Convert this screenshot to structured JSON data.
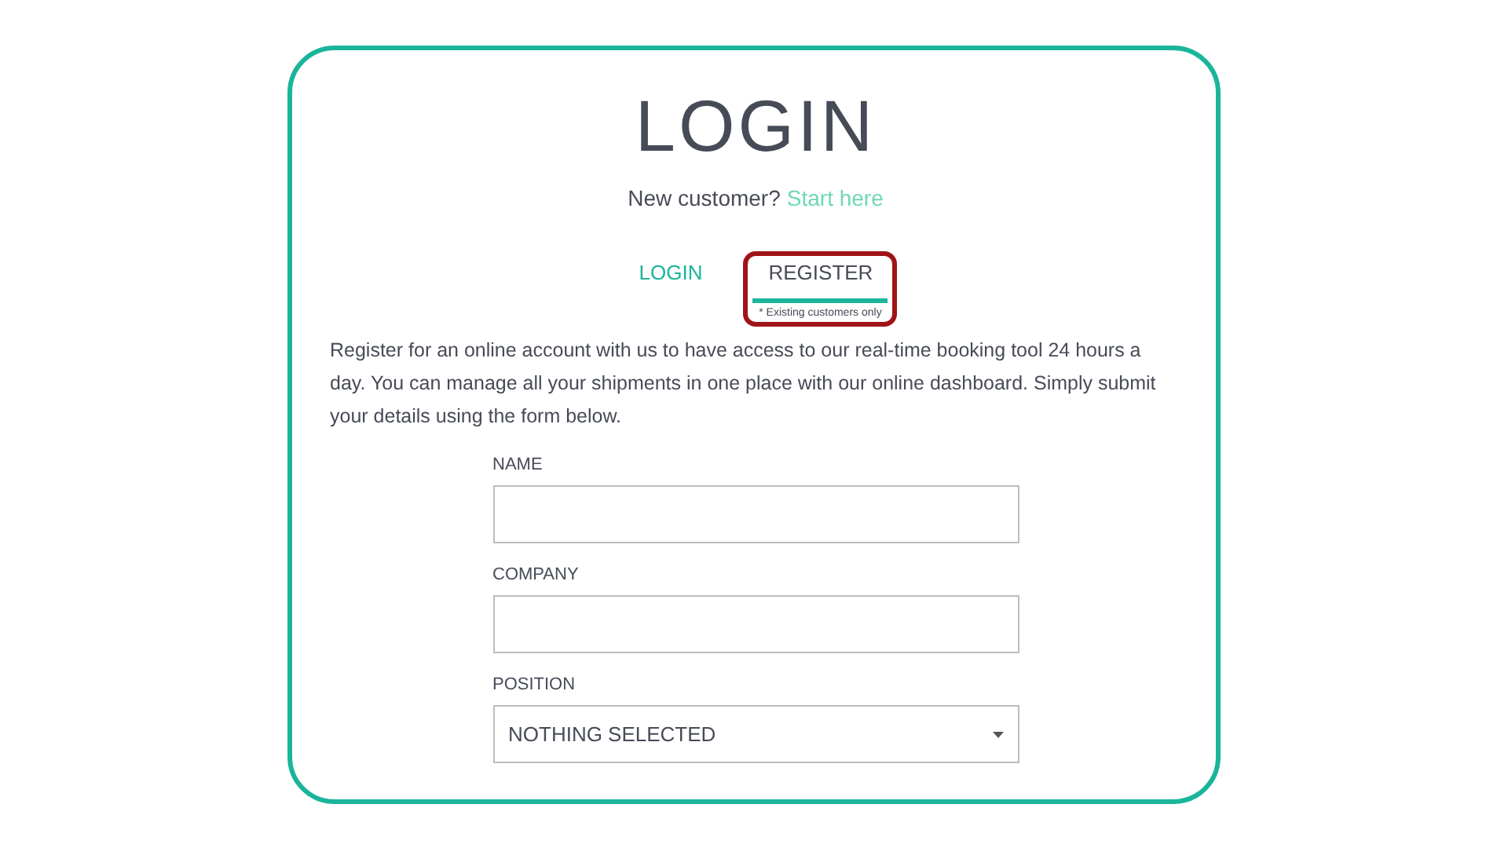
{
  "title": "LOGIN",
  "prompt": {
    "text": "New customer?",
    "link": "Start here"
  },
  "tabs": [
    {
      "label": "LOGIN",
      "selected": false,
      "highlighted": false
    },
    {
      "label": "REGISTER",
      "selected": true,
      "highlighted": true,
      "note": "* Existing customers only"
    }
  ],
  "intro": "Register for an online account with us to have access to our real-time booking tool 24 hours a day. You can manage all your shipments in one place with our online dashboard. Simply submit your details using the form below.",
  "fields": [
    {
      "kind": "text",
      "label": "NAME"
    },
    {
      "kind": "text",
      "label": "COMPANY"
    },
    {
      "kind": "select",
      "label": "POSITION",
      "value": "NOTHING SELECTED"
    }
  ]
}
